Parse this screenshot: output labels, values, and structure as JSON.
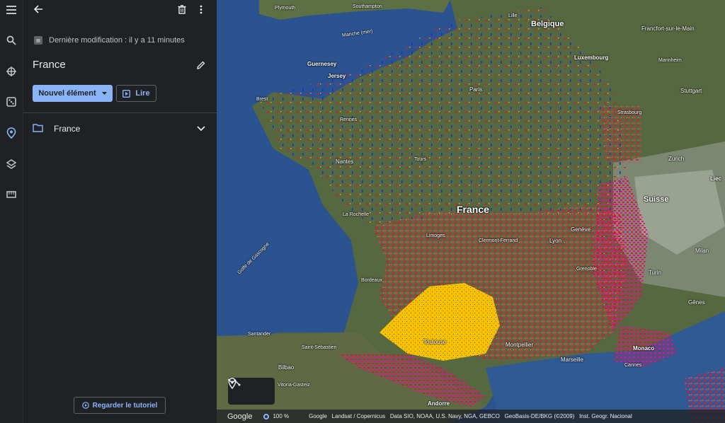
{
  "rail": {
    "items": [
      {
        "icon": "menu-icon"
      },
      {
        "icon": "search-icon"
      },
      {
        "icon": "voyager-icon"
      },
      {
        "icon": "dice-icon"
      },
      {
        "icon": "projects-icon"
      },
      {
        "icon": "layers-icon"
      },
      {
        "icon": "ruler-icon"
      }
    ]
  },
  "panel": {
    "last_modified": "Dernière modification : il y a 11 minutes",
    "title": "France",
    "new_button": "Nouvel élément",
    "play_button": "Lire",
    "folder_name": "France",
    "tutorial_button": "Regarder le tutoriel"
  },
  "map": {
    "labels": {
      "plymouth": "Plymouth",
      "southampton": "Southampton",
      "belgique": "Belgique",
      "lille": "Lille",
      "francfort": "Francfort-sur-le-Main",
      "manche": "Manche (mer)",
      "luxembourg": "Luxembourg",
      "guernesey": "Guernesey",
      "jersey": "Jersey",
      "mannheim": "Mannheim",
      "paris": "Paris",
      "stuttgart": "Stuttgart",
      "brest": "Brest",
      "strasbourg": "Strasbourg",
      "rennes": "Rennes",
      "tours": "Tours",
      "nantes": "Nantes",
      "zurich": "Zurich",
      "suisse": "Suisse",
      "liec": "Liec",
      "france": "France",
      "rochelle": "La Rochelle",
      "geneve": "Genève",
      "limoges": "Limoges",
      "clermont": "Clermont-Ferrand",
      "lyon": "Lyon",
      "milan": "Milan",
      "grenoble": "Grenoble",
      "gascogne": "Golfe de Gascogne",
      "turin": "Turin",
      "bordeaux": "Bordeaux",
      "genes": "Gênes",
      "santander": "Santander",
      "toulouse": "Toulouse",
      "montpellier": "Montpellier",
      "monaco": "Monaco",
      "sebastien": "Saint-Sébastien",
      "bilbao": "Bilbao",
      "marseille": "Marseille",
      "cannes": "Cannes",
      "vitoria": "Vitoria-Gasteiz",
      "andorre": "Andorre"
    },
    "attribution": {
      "google": "Google",
      "zoom": "100 %",
      "credits": "Google   Landsat / Copernicus   Data SIO, NOAA, U.S. Navy, NGA, GEBCO   GeoBasis-DE/BKG (©2009)   Inst. Geogr. Nacional"
    }
  },
  "colors": {
    "accent": "#8ab4f8",
    "panel_bg": "#202124",
    "red": "#e8103a",
    "yellow": "#f5c400",
    "blue": "#1a2dd8",
    "magenta": "#e0109a"
  }
}
